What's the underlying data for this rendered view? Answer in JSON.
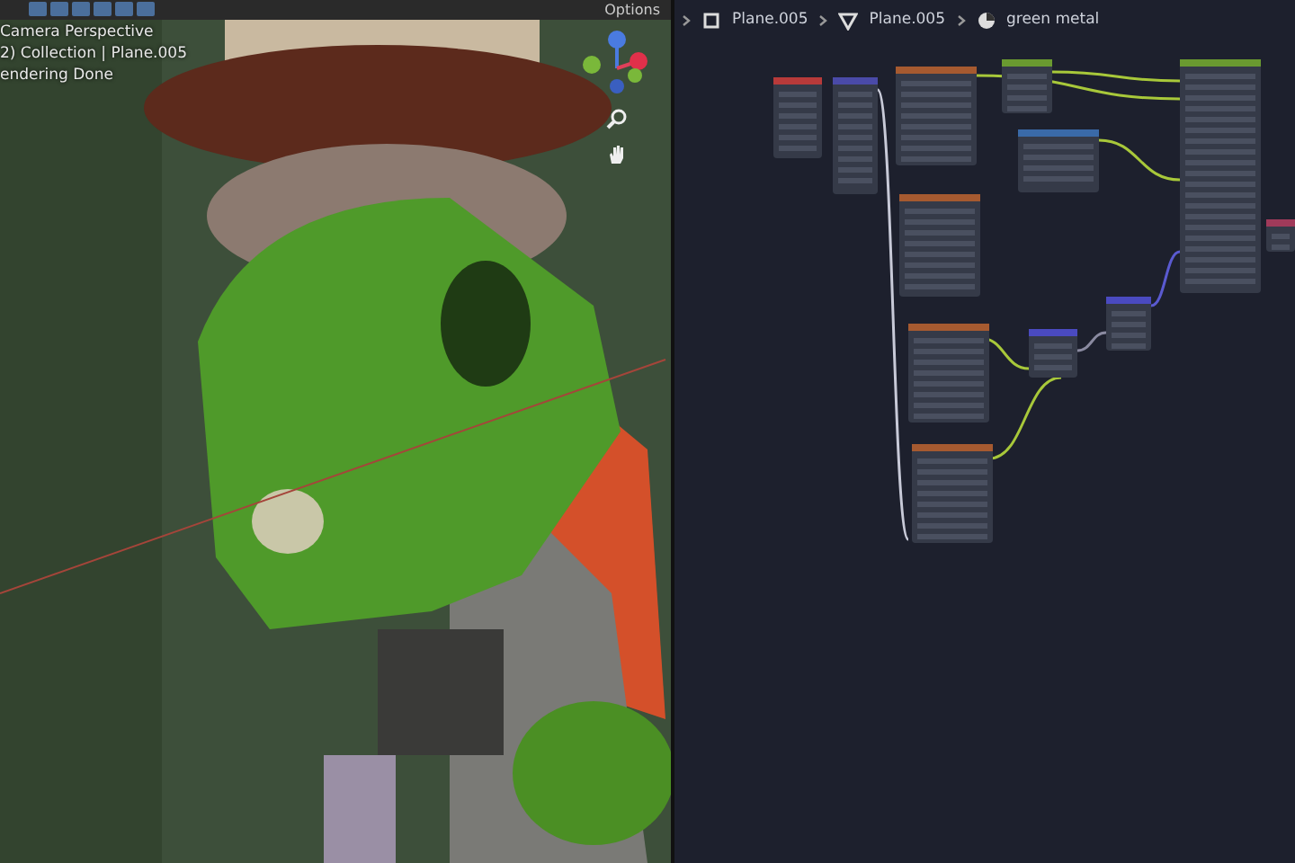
{
  "viewport": {
    "overlay_lines": [
      "Camera Perspective",
      "2) Collection | Plane.005",
      "endering Done"
    ],
    "options_label": "Options"
  },
  "breadcrumbs": [
    {
      "label": "Plane.005",
      "kind": "object"
    },
    {
      "label": "Plane.005",
      "kind": "mesh"
    },
    {
      "label": "green metal",
      "kind": "material"
    }
  ]
}
